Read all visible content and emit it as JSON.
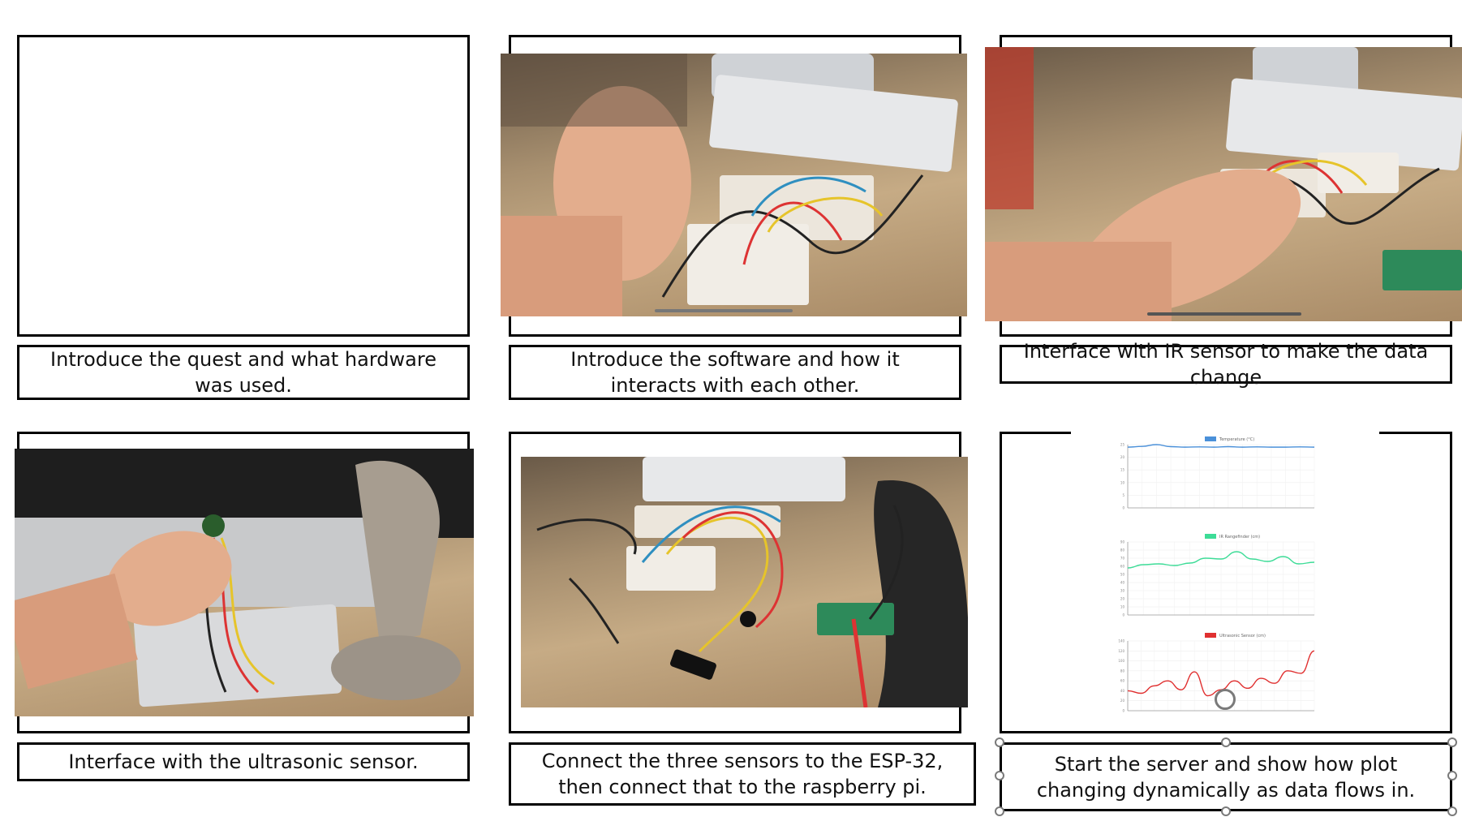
{
  "panels": [
    {
      "caption": "Introduce the quest and what hardware was used."
    },
    {
      "caption": "Introduce the software and how it interacts with each other."
    },
    {
      "caption": "Interface with IR sensor to make the data change"
    },
    {
      "caption": "Interface with the ultrasonic sensor."
    },
    {
      "caption": "Connect the three sensors to the ESP-32, then connect that to the raspberry pi."
    },
    {
      "caption": "Start the server and show how plot changing dynamically as data flows in."
    }
  ],
  "chart_data": [
    {
      "type": "line",
      "series": [
        {
          "name": "Temperature (°C)",
          "color": "#4a90d9",
          "values": [
            24,
            24.3,
            25,
            24.2,
            24,
            24.1,
            24,
            24.2,
            24,
            24.1,
            24,
            24,
            24.1,
            24
          ]
        }
      ],
      "ylim": [
        0,
        25
      ],
      "yticks": [
        "0",
        "5",
        "10",
        "15",
        "20",
        "25"
      ]
    },
    {
      "type": "line",
      "series": [
        {
          "name": "IR Rangefinder (cm)",
          "color": "#3ddc97",
          "values": [
            58,
            62,
            63,
            61,
            64,
            70,
            69,
            78,
            69,
            66,
            72,
            63,
            65
          ]
        }
      ],
      "ylim": [
        0,
        90
      ],
      "yticks": [
        "0",
        "10",
        "20",
        "30",
        "40",
        "50",
        "60",
        "70",
        "80",
        "90"
      ]
    },
    {
      "type": "line",
      "series": [
        {
          "name": "Ultrasonic Sensor (cm)",
          "color": "#e03030",
          "values": [
            40,
            35,
            50,
            60,
            42,
            78,
            30,
            42,
            60,
            45,
            65,
            55,
            80,
            75,
            120
          ]
        }
      ],
      "ylim": [
        0,
        140
      ],
      "yticks": [
        "0",
        "20",
        "40",
        "60",
        "80",
        "100",
        "120",
        "140"
      ]
    }
  ]
}
